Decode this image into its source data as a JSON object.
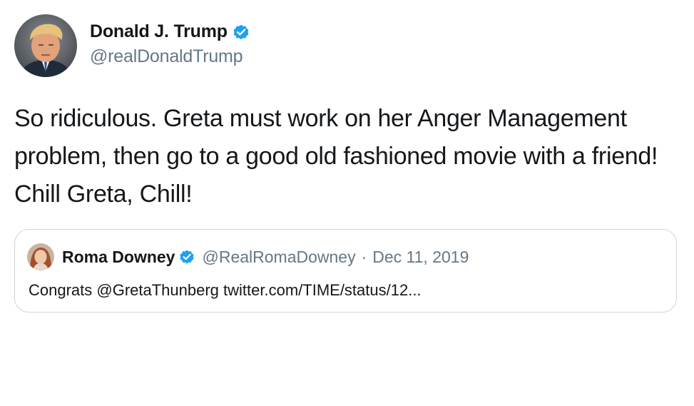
{
  "author": {
    "display_name": "Donald J. Trump",
    "handle": "@realDonaldTrump",
    "verified": true,
    "avatar_icon": "profile-photo",
    "verified_icon": "verified-badge-icon"
  },
  "tweet": {
    "text": "So ridiculous. Greta must work on her Anger Management problem, then go to a good old fashioned movie with a friend! Chill Greta, Chill!"
  },
  "quoted_tweet": {
    "display_name": "Roma Downey",
    "handle": "@RealRomaDowney",
    "separator": "·",
    "date": "Dec 11, 2019",
    "verified": true,
    "text": "Congrats @GretaThunberg twitter.com/TIME/status/12..."
  },
  "colors": {
    "text_primary": "#14171a",
    "text_secondary": "#657786",
    "verified_blue": "#1da1f2",
    "border": "#ccd6dd"
  }
}
